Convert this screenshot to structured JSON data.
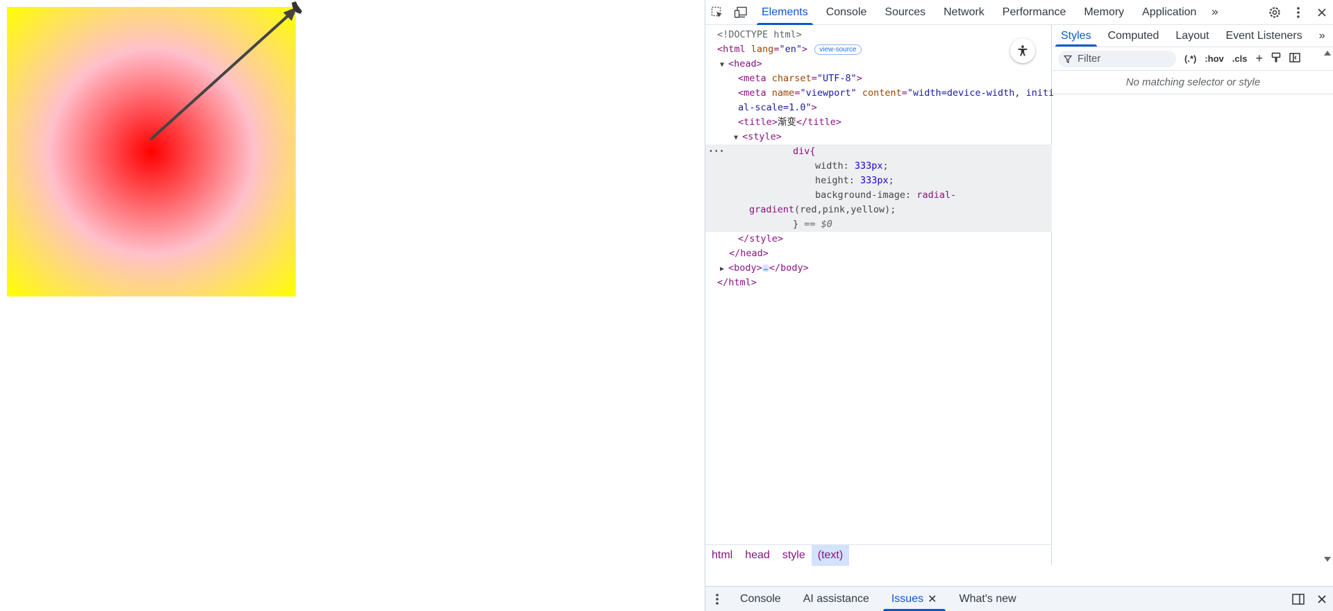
{
  "toolbar": {
    "tabs": [
      "Elements",
      "Console",
      "Sources",
      "Network",
      "Performance",
      "Memory",
      "Application"
    ],
    "active_tab": "Elements",
    "more": "»"
  },
  "dom": {
    "doctype": "<!DOCTYPE html>",
    "html_open_tag": "html",
    "html_lang_attr": "lang",
    "html_lang_val": "\"en\"",
    "view_source": "view-source",
    "head": "head",
    "meta_tag": "meta",
    "meta_charset_attr": "charset",
    "meta_charset_val": "\"UTF-8\"",
    "meta_name_attr": "name",
    "meta_name_val": "\"viewport\"",
    "meta_content_attr": "content",
    "meta_content_val_1": "\"width=device-width, initi",
    "meta_content_val_2": "al-scale=1.0\"",
    "title_tag": "title",
    "title_text": "渐变",
    "style_tag": "style",
    "css_selector": "div{",
    "css_width_prop": "width: ",
    "css_width_val": "333px",
    "css_height_prop": "height: ",
    "css_height_val": "333px",
    "css_bg_prop": "background-image: ",
    "css_bg_val_1": "radial-",
    "css_bg_val_2": "gradient",
    "css_bg_args": "(red,pink,yellow)",
    "css_close": "}",
    "eq_marker": "== $0",
    "body_tag": "body",
    "ellipsis": "…",
    "semicolon": ";"
  },
  "breadcrumb": [
    "html",
    "head",
    "style",
    "(text)"
  ],
  "breadcrumb_active": "(text)",
  "styles": {
    "tabs": [
      "Styles",
      "Computed",
      "Layout",
      "Event Listeners"
    ],
    "active_tab": "Styles",
    "more": "»",
    "filter_placeholder": "Filter",
    "regex_btn": "(.*)",
    "hov_btn": ":hov",
    "cls_btn": ".cls",
    "no_match": "No matching selector or style"
  },
  "drawer": {
    "tabs": [
      "Console",
      "AI assistance",
      "Issues",
      "What's new"
    ],
    "active_tab": "Issues"
  },
  "colors": {
    "accent": "#0b57d0",
    "tag": "#881280",
    "attr": "#994500",
    "value": "#1a1aa6"
  }
}
